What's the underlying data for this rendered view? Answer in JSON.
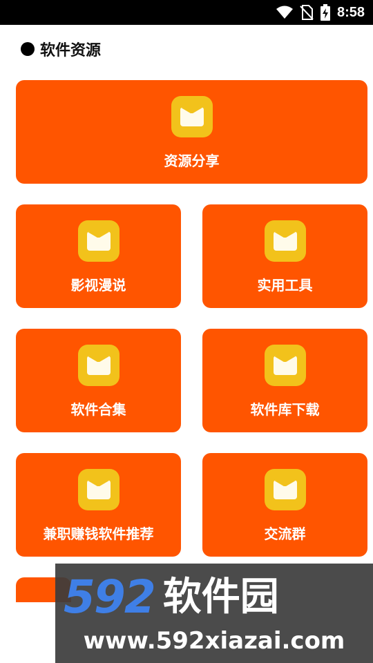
{
  "status_bar": {
    "time": "8:58",
    "icons": [
      "wifi-icon",
      "no-sim-icon",
      "battery-charging-icon"
    ]
  },
  "section": {
    "title": "软件资源"
  },
  "cards": [
    {
      "label": "资源分享",
      "icon": "folder-icon"
    },
    {
      "label": "影视漫说",
      "icon": "folder-icon"
    },
    {
      "label": "实用工具",
      "icon": "folder-icon"
    },
    {
      "label": "软件合集",
      "icon": "folder-icon"
    },
    {
      "label": "软件库下载",
      "icon": "folder-icon"
    },
    {
      "label": "兼职赚钱软件推荐",
      "icon": "folder-icon"
    },
    {
      "label": "交流群",
      "icon": "folder-icon"
    }
  ],
  "watermark": {
    "digits": "592",
    "name": "软件园",
    "url": "www.592xiazai.com"
  },
  "colors": {
    "card_background": "#ff5500",
    "icon_background": "#f2c21b",
    "status_bar": "#000000",
    "watermark_blue": "#3f7fe6"
  }
}
